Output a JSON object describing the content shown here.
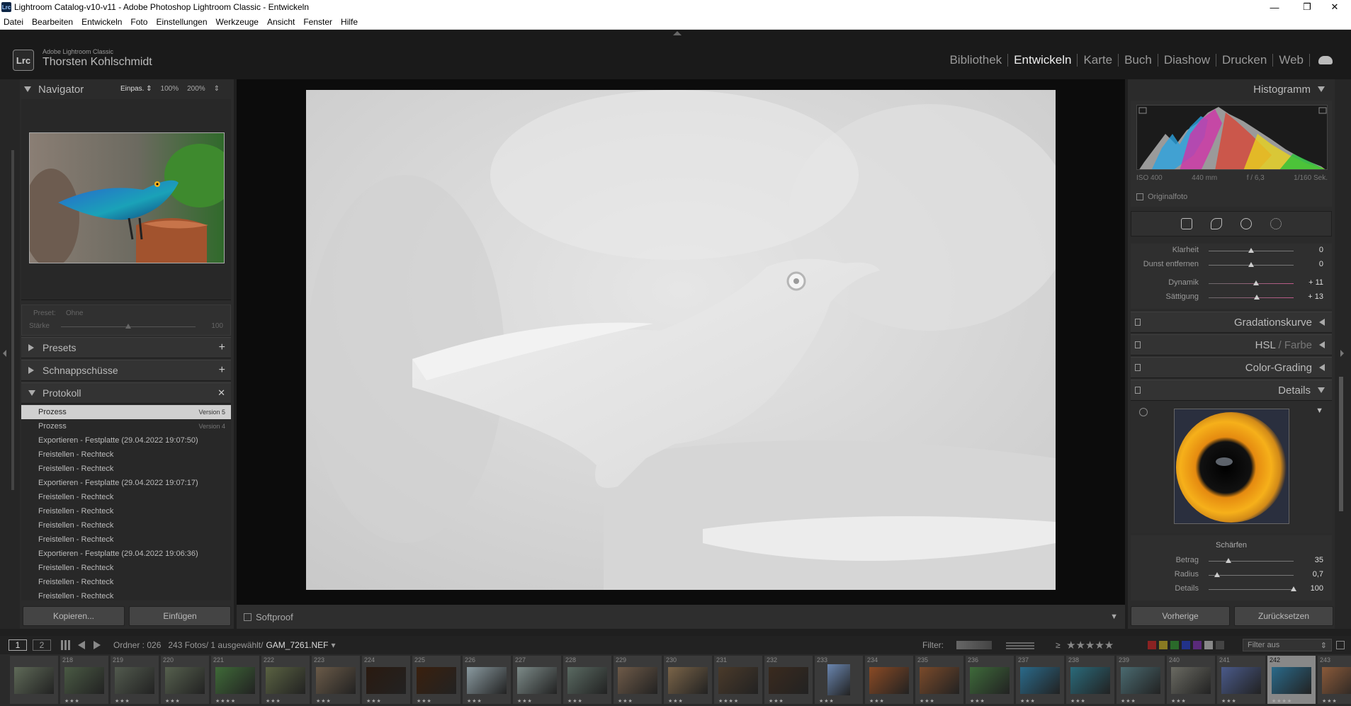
{
  "window": {
    "title": "Lightroom Catalog-v10-v11 - Adobe Photoshop Lightroom Classic - Entwickeln",
    "badge": "Lrc",
    "minimize": "—",
    "restore": "❐",
    "close": "✕"
  },
  "menu": [
    "Datei",
    "Bearbeiten",
    "Entwickeln",
    "Foto",
    "Einstellungen",
    "Werkzeuge",
    "Ansicht",
    "Fenster",
    "Hilfe"
  ],
  "identity": {
    "logo": "Lrc",
    "product": "Adobe Lightroom Classic",
    "user": "Thorsten Kohlschmidt"
  },
  "modules": [
    {
      "label": "Bibliothek",
      "active": false
    },
    {
      "label": "Entwickeln",
      "active": true
    },
    {
      "label": "Karte",
      "active": false
    },
    {
      "label": "Buch",
      "active": false
    },
    {
      "label": "Diashow",
      "active": false
    },
    {
      "label": "Drucken",
      "active": false
    },
    {
      "label": "Web",
      "active": false
    }
  ],
  "navigator": {
    "title": "Navigator",
    "zoom_fit": "Einpas. ⇕",
    "zoom_100": "100%",
    "zoom_200": "200%",
    "zoom_more": "⇕"
  },
  "preset": {
    "label": "Preset:",
    "value": "Ohne",
    "strength_label": "Stärke",
    "strength_value": "100",
    "strength_level": 0.5
  },
  "sections_left": {
    "presets": "Presets",
    "snapshots": "Schnappschüsse",
    "history": "Protokoll",
    "add": "+",
    "clear": "✕"
  },
  "history": [
    {
      "label": "Prozess",
      "version": "Version 5",
      "selected": true
    },
    {
      "label": "Prozess",
      "version": "Version 4",
      "selected": false
    },
    {
      "label": "Exportieren - Festplatte (29.04.2022 19:07:50)",
      "version": "",
      "selected": false
    },
    {
      "label": "Freistellen - Rechteck",
      "version": "",
      "selected": false
    },
    {
      "label": "Freistellen - Rechteck",
      "version": "",
      "selected": false
    },
    {
      "label": "Exportieren - Festplatte (29.04.2022 19:07:17)",
      "version": "",
      "selected": false
    },
    {
      "label": "Freistellen - Rechteck",
      "version": "",
      "selected": false
    },
    {
      "label": "Freistellen - Rechteck",
      "version": "",
      "selected": false
    },
    {
      "label": "Freistellen - Rechteck",
      "version": "",
      "selected": false
    },
    {
      "label": "Freistellen - Rechteck",
      "version": "",
      "selected": false
    },
    {
      "label": "Exportieren - Festplatte (29.04.2022 19:06:36)",
      "version": "",
      "selected": false
    },
    {
      "label": "Freistellen - Rechteck",
      "version": "",
      "selected": false
    },
    {
      "label": "Freistellen - Rechteck",
      "version": "",
      "selected": false
    },
    {
      "label": "Freistellen - Rechteck",
      "version": "",
      "selected": false
    }
  ],
  "left_buttons": {
    "copy": "Kopieren...",
    "paste": "Einfügen"
  },
  "toolbar": {
    "softproof": "Softproof",
    "menu": "▼"
  },
  "histogram": {
    "title": "Histogramm",
    "iso": "ISO 400",
    "focal": "440 mm",
    "aperture": "f / 6,3",
    "shutter": "1/160 Sek.",
    "original": "Originalfoto"
  },
  "basic_sliders": [
    {
      "name": "Klarheit",
      "value": "0",
      "level": 0.5
    },
    {
      "name": "Dunst entfernen",
      "value": "0",
      "level": 0.5
    },
    {
      "name": "Dynamik",
      "value": "+ 11",
      "level": 0.555
    },
    {
      "name": "Sättigung",
      "value": "+ 13",
      "level": 0.565
    }
  ],
  "right_sections": {
    "tone_curve": "Gradationskurve",
    "hsl": "HSL",
    "hsl_sep": "/",
    "color": "Farbe",
    "color_grading": "Color-Grading",
    "details": "Details",
    "expand": "▼"
  },
  "sharpening": {
    "title": "Schärfen",
    "rows": [
      {
        "name": "Betrag",
        "value": "35",
        "level": 0.23
      },
      {
        "name": "Radius",
        "value": "0,7",
        "level": 0.1
      },
      {
        "name": "Details",
        "value": "100",
        "level": 1.0
      }
    ]
  },
  "right_buttons": {
    "prev": "Vorherige",
    "reset": "Zurücksetzen"
  },
  "filmbar": {
    "screen1": "1",
    "screen2": "2",
    "folder": "Ordner : 026",
    "count": "243 Fotos/ 1 ausgewählt/",
    "file": "GAM_7261.NEF",
    "file_arrow": "▾",
    "filter_label": "Filter:",
    "rating_op": "≥",
    "stars": "★★★★★",
    "filter_value": "Filter aus",
    "filter_arrow": "⇕"
  },
  "film": [
    {
      "num": "",
      "stars": "",
      "color": "#5f6a58"
    },
    {
      "num": "218",
      "stars": "★★★",
      "color": "#4a5a44"
    },
    {
      "num": "219",
      "stars": "★★★",
      "color": "#525a4e"
    },
    {
      "num": "220",
      "stars": "★★★",
      "color": "#56604e"
    },
    {
      "num": "221",
      "stars": "★★★★",
      "color": "#3f6a38"
    },
    {
      "num": "222",
      "stars": "★★★",
      "color": "#5a6242"
    },
    {
      "num": "223",
      "stars": "★★★",
      "color": "#6a5a48"
    },
    {
      "num": "224",
      "stars": "★★★",
      "color": "#2a1a10"
    },
    {
      "num": "225",
      "stars": "★★★",
      "color": "#3a200e"
    },
    {
      "num": "226",
      "stars": "★★★",
      "color": "#8a9aa0"
    },
    {
      "num": "227",
      "stars": "★★★",
      "color": "#7c8a88"
    },
    {
      "num": "228",
      "stars": "★★★",
      "color": "#5a6a62"
    },
    {
      "num": "229",
      "stars": "★★★",
      "color": "#6e5a48"
    },
    {
      "num": "230",
      "stars": "★★★",
      "color": "#7a6448"
    },
    {
      "num": "231",
      "stars": "★★★★",
      "color": "#4a3a2a"
    },
    {
      "num": "232",
      "stars": "★★★",
      "color": "#3a2a1e"
    },
    {
      "num": "233",
      "stars": "★★★",
      "color": "#6a86b0"
    },
    {
      "num": "234",
      "stars": "★★★",
      "color": "#8a4a24"
    },
    {
      "num": "235",
      "stars": "★★★",
      "color": "#7a4a2a"
    },
    {
      "num": "236",
      "stars": "★★★",
      "color": "#3e6a3a"
    },
    {
      "num": "237",
      "stars": "★★★",
      "color": "#2a6a8a"
    },
    {
      "num": "238",
      "stars": "★★★",
      "color": "#2a6a7a"
    },
    {
      "num": "239",
      "stars": "★★★",
      "color": "#4a6a70"
    },
    {
      "num": "240",
      "stars": "★★★",
      "color": "#6a6a62"
    },
    {
      "num": "241",
      "stars": "★★★",
      "color": "#4a5a8a"
    },
    {
      "num": "242",
      "stars": "★★★★",
      "color": "#2a6a8a"
    },
    {
      "num": "243",
      "stars": "★★★",
      "color": "#8a5a3a"
    }
  ],
  "icons": {
    "crop": "crop-icon",
    "heal": "healing-brush-icon",
    "redeye": "red-eye-icon",
    "mask": "masking-icon",
    "grid": "grid-view-icon",
    "back": "arrow-left-icon",
    "forward": "arrow-right-icon",
    "cloud": "cloud-icon"
  },
  "colors": {
    "accent": "#d0d0d0",
    "background": "#1f1f1f",
    "panel": "#2b2b2b"
  }
}
